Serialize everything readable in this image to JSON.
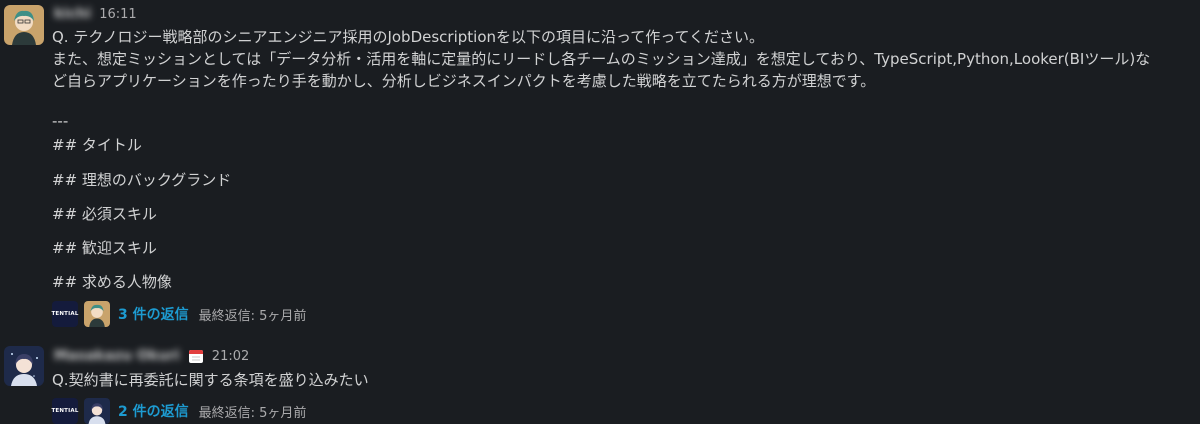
{
  "messages": [
    {
      "sender": "kichi",
      "time": "16:11",
      "lines": [
        "Q. テクノロジー戦略部のシニアエンジニア採用のJobDescriptionを以下の項目に沿って作ってください。",
        "また、想定ミッションとしては「データ分析・活用を軸に定量的にリードし各チームのミッション達成」を想定しており、TypeScript,Python,Looker(BIツール)な",
        "ど自らアプリケーションを作ったり手を動かし、分析しビジネスインパクトを考慮した戦略を立てたられる方が理想です。"
      ],
      "separator": "---",
      "sections": [
        "## タイトル",
        "## 理想のバックグランド",
        "## 必須スキル",
        "## 歓迎スキル",
        "## 求める人物像"
      ],
      "thread": {
        "workspace_badge": "TENTIAL",
        "reply_count": "3 件の返信",
        "last_reply": "最終返信: 5ヶ月前"
      }
    },
    {
      "sender": "Masakazu Okuri",
      "status_icon": "calendar-icon",
      "time": "21:02",
      "lines": [
        "Q.契約書に再委託に関する条項を盛り込みたい"
      ],
      "thread": {
        "workspace_badge": "TENTIAL",
        "reply_count": "2 件の返信",
        "last_reply": "最終返信: 5ヶ月前"
      }
    }
  ],
  "colors": {
    "background": "#1a1d21",
    "text": "#d1d2d3",
    "muted": "#ababad",
    "link": "#1d9bd1",
    "badge": "#141b3c"
  }
}
